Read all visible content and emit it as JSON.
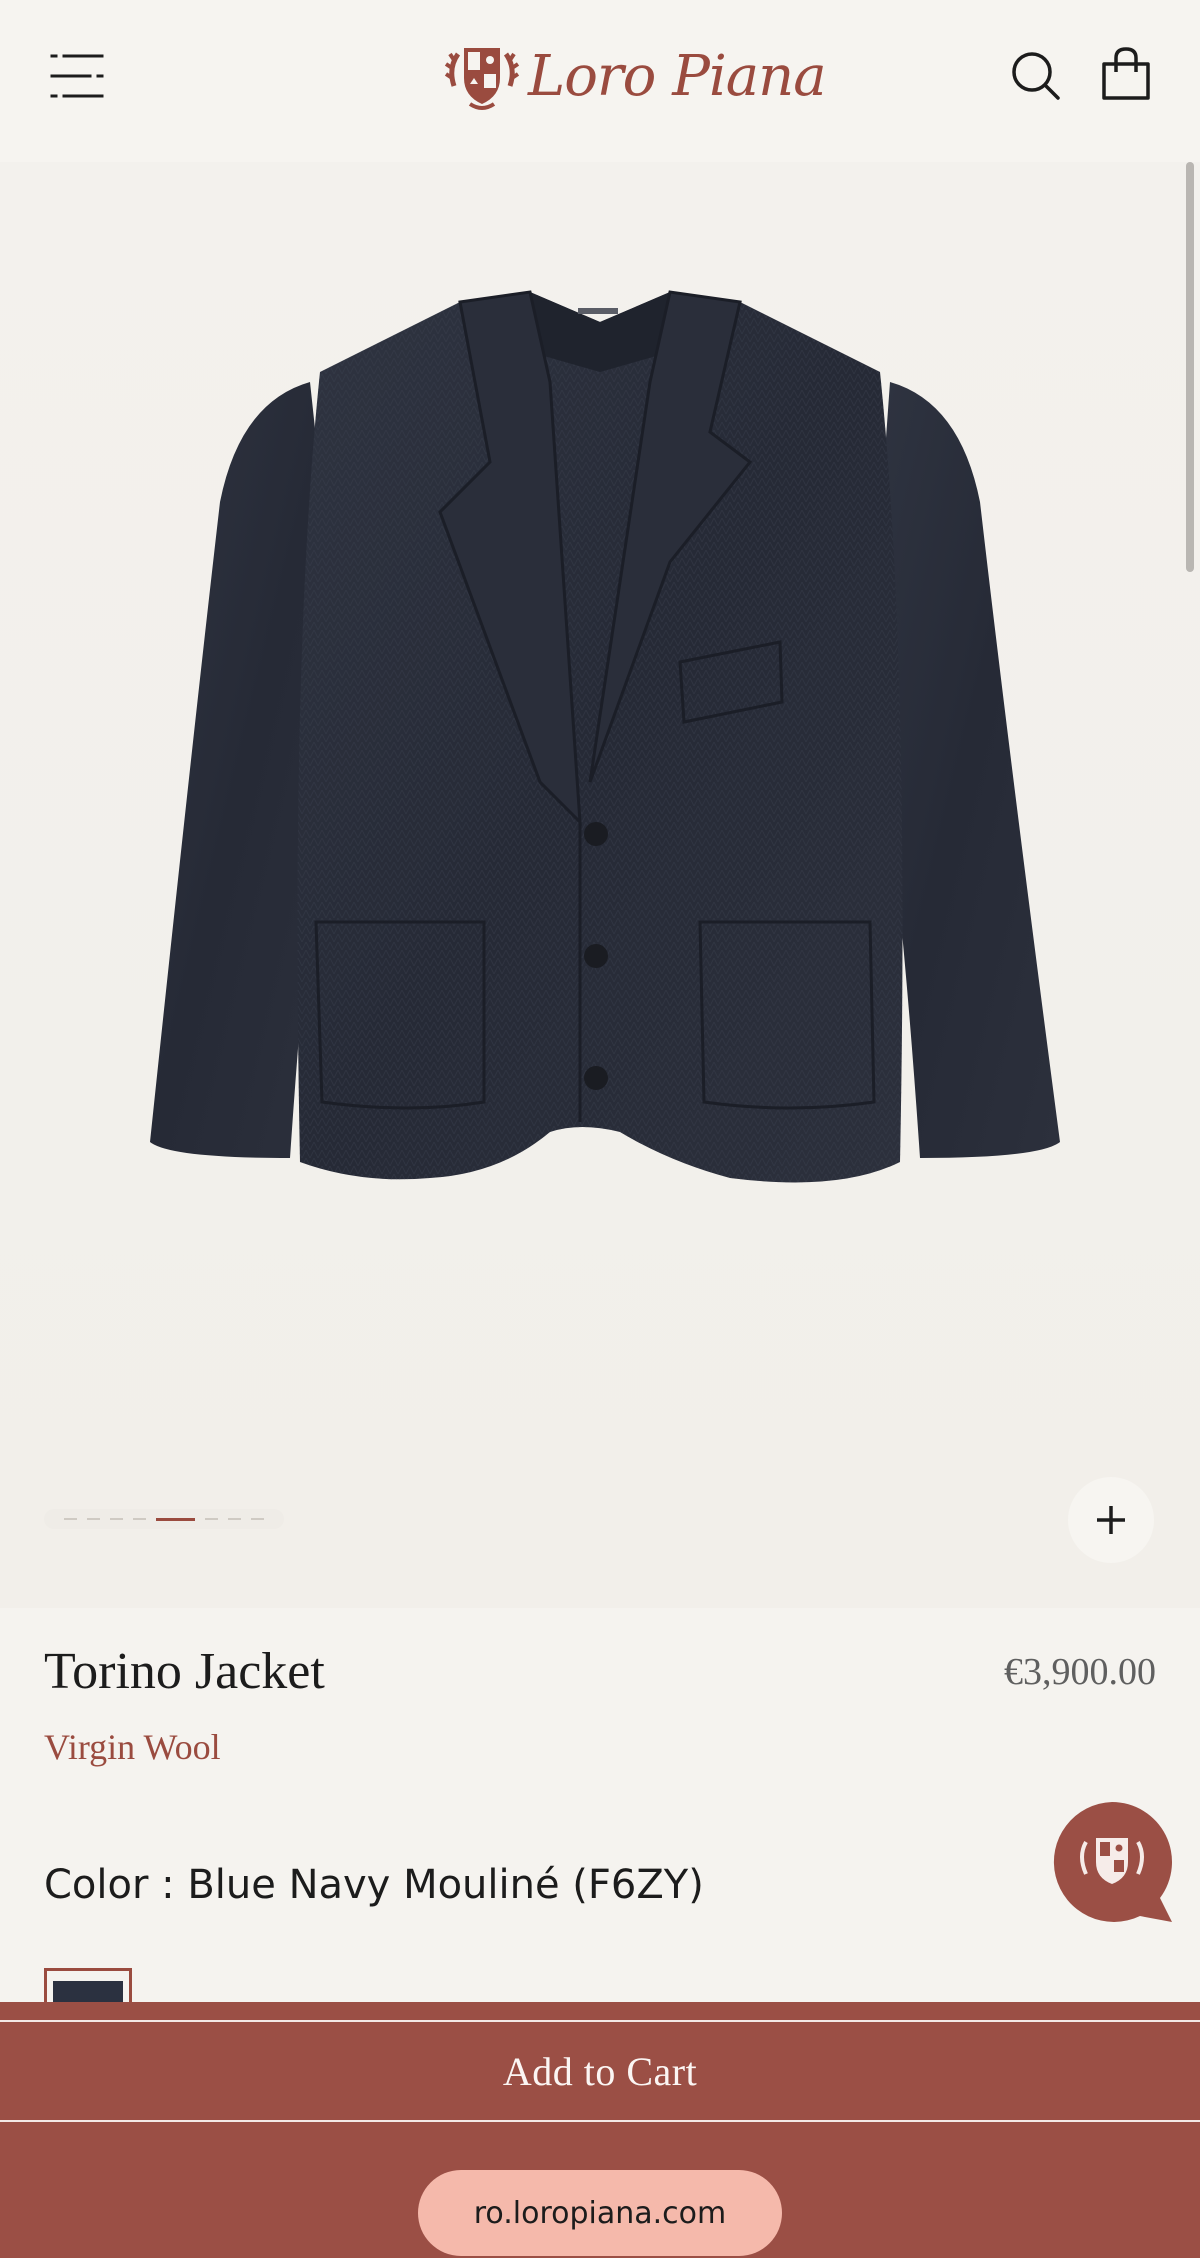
{
  "brand": {
    "logo_text": "Loro Piana"
  },
  "header": {
    "menu_icon": "menu-icon",
    "search_icon": "search-icon",
    "bag_icon": "shopping-bag-icon"
  },
  "gallery": {
    "image_count": 8,
    "active_index": 4,
    "zoom_icon": "plus-icon"
  },
  "product": {
    "name": "Torino Jacket",
    "price": "€3,900.00",
    "material": "Virgin Wool",
    "color_label": "Color : Blue Navy Mouliné (F6ZY)",
    "swatch_color": "#2b3140"
  },
  "actions": {
    "add_to_cart": "Add to Cart"
  },
  "browser": {
    "url": "ro.loropiana.com"
  },
  "colors": {
    "brand": "#9a4b3f",
    "cart_bar": "#9b4f45",
    "url_pill": "#f5b9ab",
    "background": "#f5f3ef"
  }
}
